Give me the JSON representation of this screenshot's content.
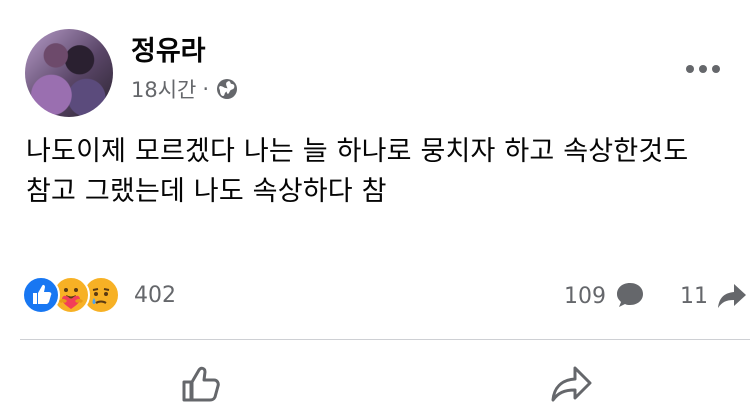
{
  "post": {
    "author": "정유라",
    "time": "18시간",
    "separator": "·",
    "text": "나도이제 모르겠다 나는 늘 하나로 뭉치자 하고 속상한것도\n참고 그랬는데 나도 속상하다 참",
    "privacy_icon": "globe-icon"
  },
  "stats": {
    "reactions": [
      "like",
      "care",
      "sad"
    ],
    "reaction_count": "402",
    "comment_count": "109",
    "share_count": "11"
  },
  "actions": {
    "like_icon": "thumbs-up-icon",
    "share_icon": "share-arrow-icon"
  },
  "colors": {
    "like_blue": "#1877f2",
    "emoji_yellow": "#f7b125",
    "secondary_text": "#65676b"
  }
}
